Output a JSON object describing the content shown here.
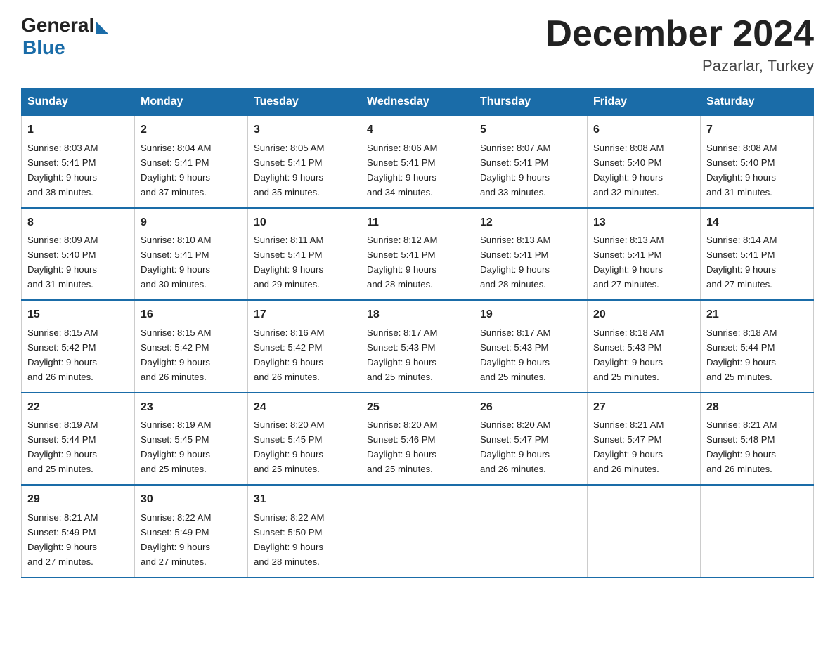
{
  "logo": {
    "text_general": "General",
    "text_blue": "Blue"
  },
  "title": "December 2024",
  "subtitle": "Pazarlar, Turkey",
  "days_header": [
    "Sunday",
    "Monday",
    "Tuesday",
    "Wednesday",
    "Thursday",
    "Friday",
    "Saturday"
  ],
  "weeks": [
    [
      {
        "day": 1,
        "sunrise": "8:03 AM",
        "sunset": "5:41 PM",
        "daylight": "9 hours and 38 minutes."
      },
      {
        "day": 2,
        "sunrise": "8:04 AM",
        "sunset": "5:41 PM",
        "daylight": "9 hours and 37 minutes."
      },
      {
        "day": 3,
        "sunrise": "8:05 AM",
        "sunset": "5:41 PM",
        "daylight": "9 hours and 35 minutes."
      },
      {
        "day": 4,
        "sunrise": "8:06 AM",
        "sunset": "5:41 PM",
        "daylight": "9 hours and 34 minutes."
      },
      {
        "day": 5,
        "sunrise": "8:07 AM",
        "sunset": "5:41 PM",
        "daylight": "9 hours and 33 minutes."
      },
      {
        "day": 6,
        "sunrise": "8:08 AM",
        "sunset": "5:40 PM",
        "daylight": "9 hours and 32 minutes."
      },
      {
        "day": 7,
        "sunrise": "8:08 AM",
        "sunset": "5:40 PM",
        "daylight": "9 hours and 31 minutes."
      }
    ],
    [
      {
        "day": 8,
        "sunrise": "8:09 AM",
        "sunset": "5:40 PM",
        "daylight": "9 hours and 31 minutes."
      },
      {
        "day": 9,
        "sunrise": "8:10 AM",
        "sunset": "5:41 PM",
        "daylight": "9 hours and 30 minutes."
      },
      {
        "day": 10,
        "sunrise": "8:11 AM",
        "sunset": "5:41 PM",
        "daylight": "9 hours and 29 minutes."
      },
      {
        "day": 11,
        "sunrise": "8:12 AM",
        "sunset": "5:41 PM",
        "daylight": "9 hours and 28 minutes."
      },
      {
        "day": 12,
        "sunrise": "8:13 AM",
        "sunset": "5:41 PM",
        "daylight": "9 hours and 28 minutes."
      },
      {
        "day": 13,
        "sunrise": "8:13 AM",
        "sunset": "5:41 PM",
        "daylight": "9 hours and 27 minutes."
      },
      {
        "day": 14,
        "sunrise": "8:14 AM",
        "sunset": "5:41 PM",
        "daylight": "9 hours and 27 minutes."
      }
    ],
    [
      {
        "day": 15,
        "sunrise": "8:15 AM",
        "sunset": "5:42 PM",
        "daylight": "9 hours and 26 minutes."
      },
      {
        "day": 16,
        "sunrise": "8:15 AM",
        "sunset": "5:42 PM",
        "daylight": "9 hours and 26 minutes."
      },
      {
        "day": 17,
        "sunrise": "8:16 AM",
        "sunset": "5:42 PM",
        "daylight": "9 hours and 26 minutes."
      },
      {
        "day": 18,
        "sunrise": "8:17 AM",
        "sunset": "5:43 PM",
        "daylight": "9 hours and 25 minutes."
      },
      {
        "day": 19,
        "sunrise": "8:17 AM",
        "sunset": "5:43 PM",
        "daylight": "9 hours and 25 minutes."
      },
      {
        "day": 20,
        "sunrise": "8:18 AM",
        "sunset": "5:43 PM",
        "daylight": "9 hours and 25 minutes."
      },
      {
        "day": 21,
        "sunrise": "8:18 AM",
        "sunset": "5:44 PM",
        "daylight": "9 hours and 25 minutes."
      }
    ],
    [
      {
        "day": 22,
        "sunrise": "8:19 AM",
        "sunset": "5:44 PM",
        "daylight": "9 hours and 25 minutes."
      },
      {
        "day": 23,
        "sunrise": "8:19 AM",
        "sunset": "5:45 PM",
        "daylight": "9 hours and 25 minutes."
      },
      {
        "day": 24,
        "sunrise": "8:20 AM",
        "sunset": "5:45 PM",
        "daylight": "9 hours and 25 minutes."
      },
      {
        "day": 25,
        "sunrise": "8:20 AM",
        "sunset": "5:46 PM",
        "daylight": "9 hours and 25 minutes."
      },
      {
        "day": 26,
        "sunrise": "8:20 AM",
        "sunset": "5:47 PM",
        "daylight": "9 hours and 26 minutes."
      },
      {
        "day": 27,
        "sunrise": "8:21 AM",
        "sunset": "5:47 PM",
        "daylight": "9 hours and 26 minutes."
      },
      {
        "day": 28,
        "sunrise": "8:21 AM",
        "sunset": "5:48 PM",
        "daylight": "9 hours and 26 minutes."
      }
    ],
    [
      {
        "day": 29,
        "sunrise": "8:21 AM",
        "sunset": "5:49 PM",
        "daylight": "9 hours and 27 minutes."
      },
      {
        "day": 30,
        "sunrise": "8:22 AM",
        "sunset": "5:49 PM",
        "daylight": "9 hours and 27 minutes."
      },
      {
        "day": 31,
        "sunrise": "8:22 AM",
        "sunset": "5:50 PM",
        "daylight": "9 hours and 28 minutes."
      },
      null,
      null,
      null,
      null
    ]
  ]
}
